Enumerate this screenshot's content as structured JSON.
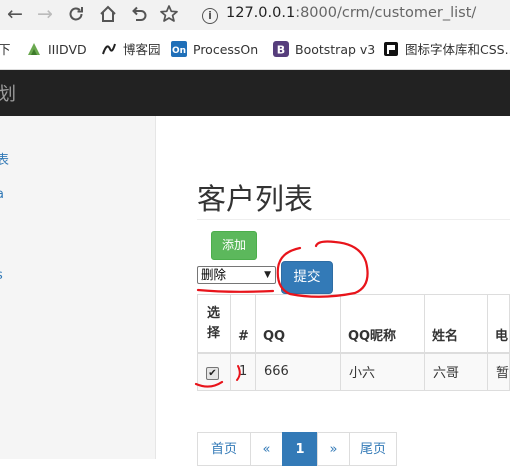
{
  "browser": {
    "url_host": "127.0.0.1",
    "url_path": ":8000/crm/customer_list/",
    "bookmarks": [
      {
        "label": "下"
      },
      {
        "label": "IIIDVD"
      },
      {
        "label": "博客园"
      },
      {
        "label": "ProcessOn"
      },
      {
        "label": "Bootstrap v3"
      },
      {
        "label": "图标字体库和CSS..."
      }
    ]
  },
  "app": {
    "brand": "划",
    "sidebar": [
      "表",
      "a",
      "s"
    ]
  },
  "main": {
    "title": "客户列表",
    "add_label": "添加",
    "action_selected": "删除",
    "submit_label": "提交",
    "table": {
      "headers": [
        "选\n择",
        "#",
        "QQ",
        "QQ昵称",
        "姓名",
        "电"
      ],
      "rows": [
        {
          "checked": true,
          "num": "1",
          "qq": "666",
          "qq_name": "小六",
          "name": "六哥",
          "phone": "暂"
        }
      ]
    },
    "pagination": [
      "首页",
      "«",
      "1",
      "»",
      "尾页"
    ],
    "active_page": "1"
  },
  "colors": {
    "navbar": "#222222",
    "add_button": "#5cb85c",
    "primary": "#337ab7",
    "annotation": "#e8141b"
  },
  "icons": [
    "back-icon",
    "forward-icon",
    "reload-icon",
    "home-icon",
    "undo-icon",
    "star-icon",
    "info-icon"
  ]
}
